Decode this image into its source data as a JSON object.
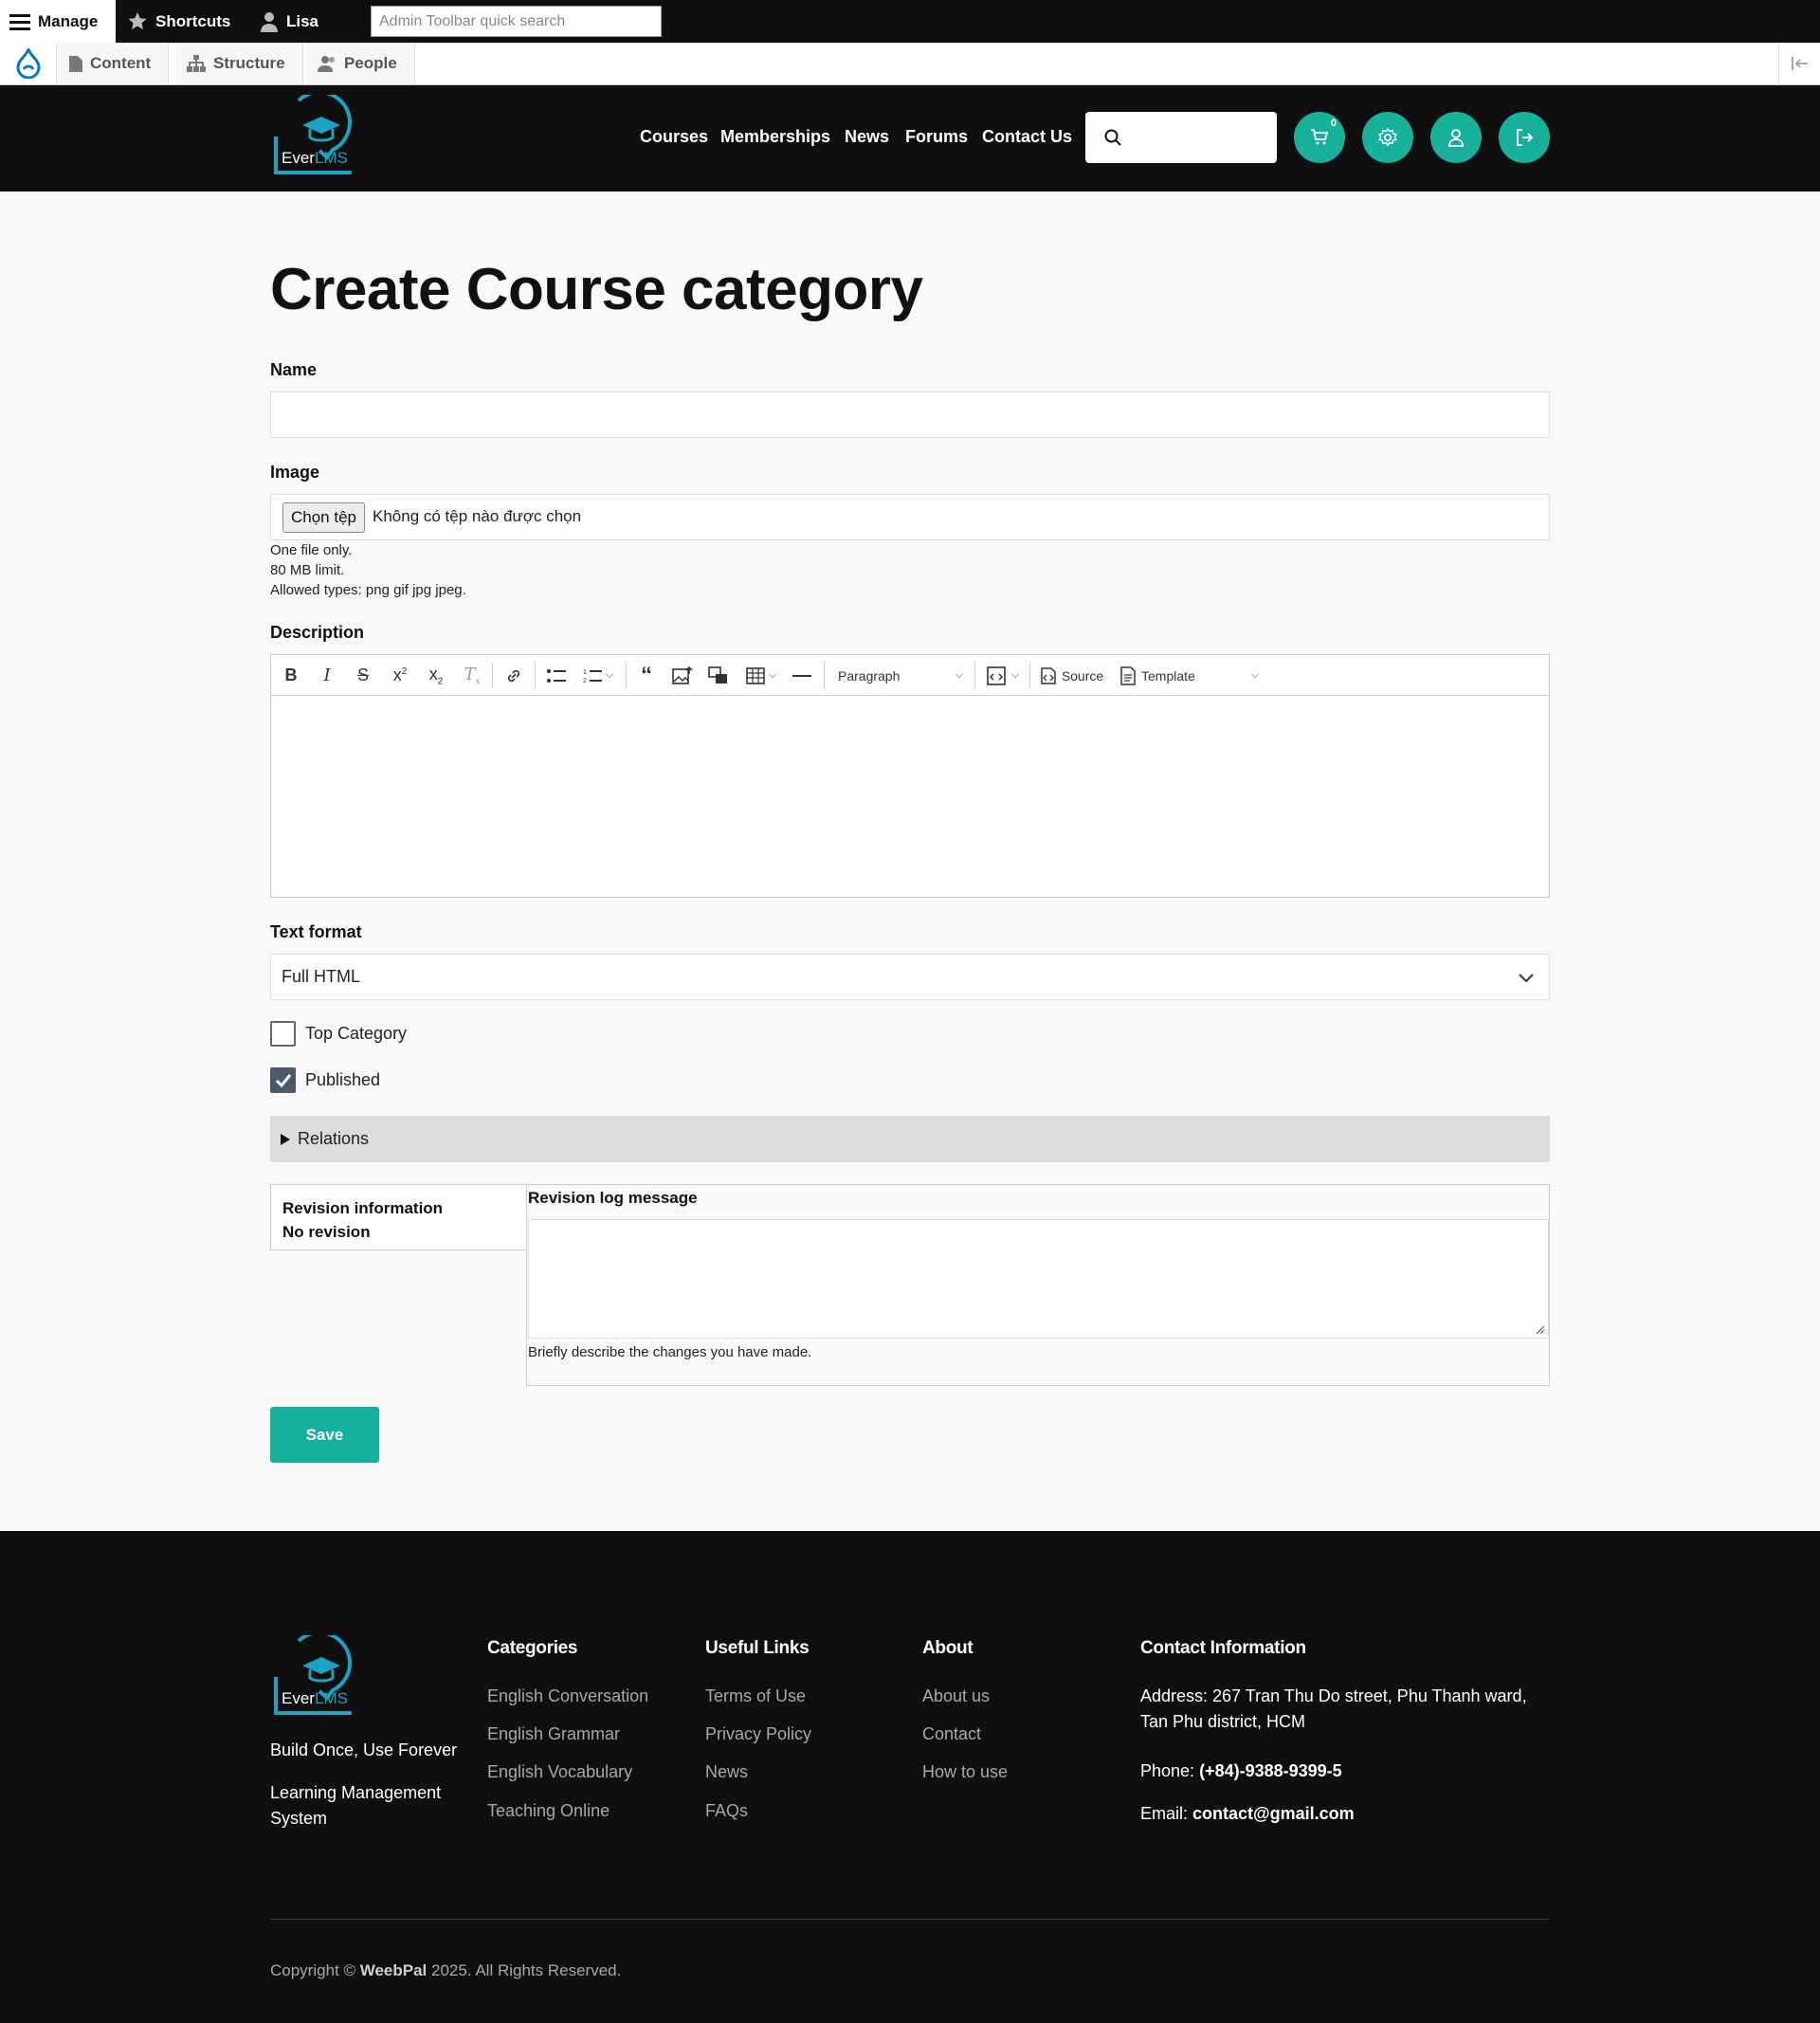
{
  "admin_toolbar": {
    "manage": "Manage",
    "shortcuts": "Shortcuts",
    "user": "Lisa",
    "search_placeholder": "Admin Toolbar quick search",
    "tabs": [
      "Content",
      "Structure",
      "People"
    ]
  },
  "header": {
    "logo_text_a": "Ever",
    "logo_text_b": "LMS",
    "nav": [
      "Courses",
      "Memberships",
      "News",
      "Forums",
      "Contact Us"
    ],
    "cart_count": "0",
    "accent_color": "#17b09b"
  },
  "form": {
    "title": "Create Course category",
    "name_label": "Name",
    "name_value": "",
    "image_label": "Image",
    "file_button": "Chọn tệp",
    "file_status": "Không có tệp nào được chọn",
    "file_help": [
      "One file only.",
      "80 MB limit.",
      "Allowed types: png gif jpg jpeg."
    ],
    "description_label": "Description",
    "editor": {
      "paragraph": "Paragraph",
      "source": "Source",
      "template": "Template",
      "content": ""
    },
    "text_format_label": "Text format",
    "text_format_value": "Full HTML",
    "top_category_label": "Top Category",
    "top_category_checked": false,
    "published_label": "Published",
    "published_checked": true,
    "relations_label": "Relations",
    "revision_info_title": "Revision information",
    "revision_info_status": "No revision",
    "revision_log_label": "Revision log message",
    "revision_log_value": "",
    "revision_help": "Briefly describe the changes you have made.",
    "save_label": "Save"
  },
  "footer": {
    "tagline": "Build Once, Use Forever",
    "subtitle": "Learning Management System",
    "categories_title": "Categories",
    "categories": [
      "English Conversation",
      "English Grammar",
      "English Vocabulary",
      "Teaching Online"
    ],
    "useful_title": "Useful Links",
    "useful": [
      "Terms of Use",
      "Privacy Policy",
      "News",
      "FAQs"
    ],
    "about_title": "About",
    "about": [
      "About us",
      "Contact",
      "How to use"
    ],
    "contact_title": "Contact Information",
    "address": "Address: 267 Tran Thu Do street, Phu Thanh ward, Tan Phu district, HCM",
    "phone_label": "Phone: ",
    "phone": "(+84)-9388-9399-5",
    "email_label": "Email: ",
    "email": "contact@gmail.com",
    "copyright_prefix": "Copyright © ",
    "copyright_brand": "WeebPal",
    "copyright_suffix": " 2025. All Rights Reserved."
  }
}
